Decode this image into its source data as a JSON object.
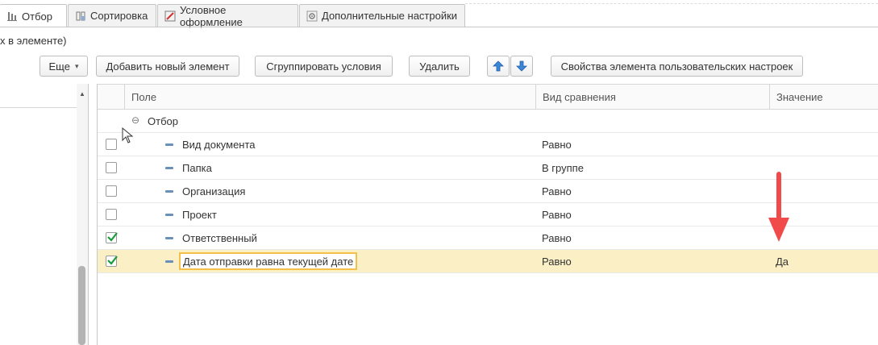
{
  "tabs": [
    {
      "label": "Отбор",
      "icon": "filter-icon",
      "active": true
    },
    {
      "label": "Сортировка",
      "icon": "sort-icon",
      "active": false
    },
    {
      "label": "Условное оформление",
      "icon": "conditional-format-icon",
      "active": false
    },
    {
      "label": "Дополнительные настройки",
      "icon": "settings-icon",
      "active": false
    }
  ],
  "breadcrumb_text": "х в элементе)",
  "toolbar": {
    "more_label": "Еще",
    "add_label": "Добавить новый элемент",
    "group_label": "Сгруппировать условия",
    "delete_label": "Удалить",
    "properties_label": "Свойства элемента пользовательских настроек"
  },
  "table": {
    "columns": [
      "Поле",
      "Вид сравнения",
      "Значение"
    ],
    "group_label": "Отбор",
    "rows": [
      {
        "field": "Вид документа",
        "comparison": "Равно",
        "value": "",
        "checked": false,
        "selected": false
      },
      {
        "field": "Папка",
        "comparison": "В группе",
        "value": "",
        "checked": false,
        "selected": false
      },
      {
        "field": "Организация",
        "comparison": "Равно",
        "value": "",
        "checked": false,
        "selected": false
      },
      {
        "field": "Проект",
        "comparison": "Равно",
        "value": "",
        "checked": false,
        "selected": false
      },
      {
        "field": "Ответственный",
        "comparison": "Равно",
        "value": "",
        "checked": true,
        "selected": false
      },
      {
        "field": "Дата отправки равна текущей дате",
        "comparison": "Равно",
        "value": "Да",
        "checked": true,
        "selected": true
      }
    ]
  },
  "colors": {
    "selected_row": "#fbefc6",
    "edit_border": "#f3c04a",
    "check_green": "#1a9a3a",
    "annotation_arrow": "#f04a4a",
    "arrow_button_blue": "#3b86d6"
  }
}
